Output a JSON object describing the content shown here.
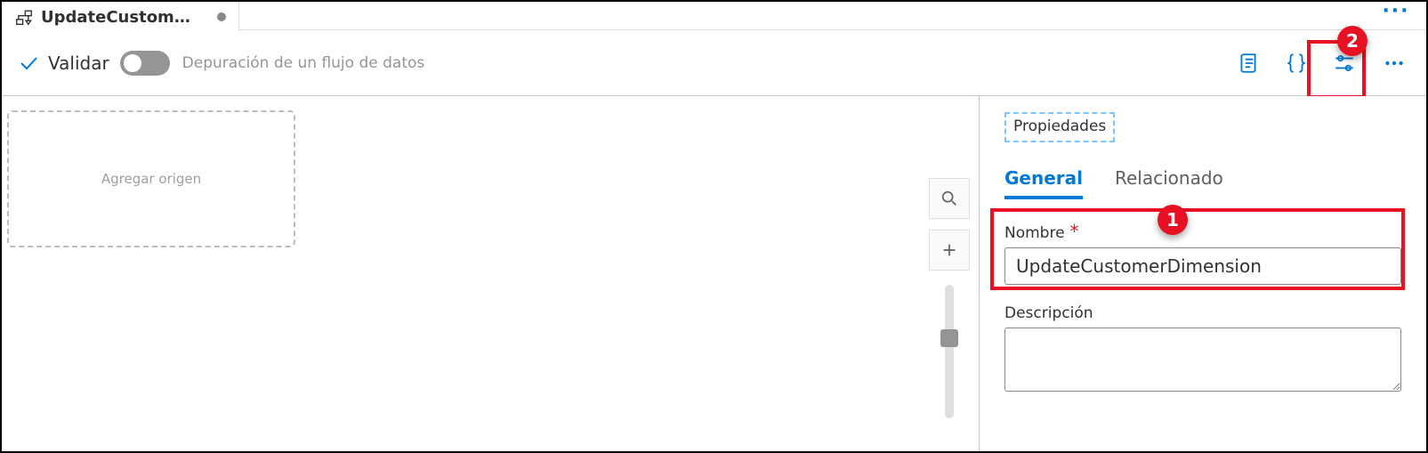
{
  "tab": {
    "title": "UpdateCustomerDi...",
    "dirty": true,
    "icon": "dataflow-icon"
  },
  "toolbar": {
    "validate_label": "Validar",
    "debug_label": "Depuración de un flujo de datos",
    "debug_on": false,
    "right_icons": [
      "script-icon",
      "braces-icon",
      "settings-sliders-icon",
      "more-icon"
    ]
  },
  "canvas": {
    "add_source_label": "Agregar origen"
  },
  "panel": {
    "properties_tab": "Propiedades",
    "subtabs": [
      {
        "label": "General",
        "active": true
      },
      {
        "label": "Relacionado",
        "active": false
      }
    ],
    "name_label": "Nombre",
    "name_value": "UpdateCustomerDimension",
    "description_label": "Descripción",
    "description_value": ""
  },
  "callouts": {
    "badge1": "1",
    "badge2": "2"
  }
}
